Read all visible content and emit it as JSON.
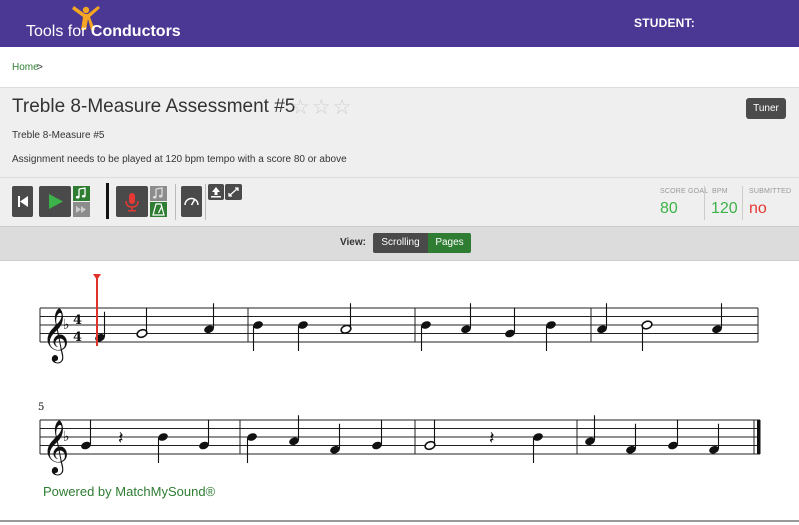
{
  "nav": {
    "logo_text_1": "Tools for ",
    "logo_text_2": "Conductors",
    "student_label": "STUDENT:"
  },
  "breadcrumb": {
    "home": "Home",
    "separator": ">"
  },
  "assessment": {
    "title": "Treble 8-Measure Assessment #5",
    "stars": "☆☆☆",
    "subtitle": "Treble 8-Measure #5",
    "requirement": "Assignment needs to be played at 120 bpm tempo with a score 80 or above",
    "tuner_label": "Tuner"
  },
  "stats": {
    "score_goal_label": "SCORE GOAL",
    "score_goal_value": "80",
    "bpm_label": "BPM",
    "bpm_value": "120",
    "submitted_label": "SUBMITTED",
    "submitted_value": "no"
  },
  "view": {
    "label": "View:",
    "options": [
      "Scrolling",
      "Pages"
    ],
    "selected": "Pages"
  },
  "score": {
    "measure_number_line2": "5",
    "time_signature": [
      "4",
      "4"
    ]
  },
  "footer": {
    "powered_by": "Powered by MatchMySound®"
  },
  "colors": {
    "nav_bg": "#4b3794",
    "accent_green": "#2e7d32",
    "record_red": "#e53935",
    "submitted_red": "#e53935",
    "playhead": "#e0312b"
  },
  "icons": [
    "person-logo-icon",
    "star-icon",
    "skip-back-icon",
    "play-icon",
    "music-note-icon",
    "fast-forward-icon",
    "microphone-icon",
    "metronome-icon",
    "speedometer-icon",
    "upload-icon",
    "expand-icon"
  ]
}
